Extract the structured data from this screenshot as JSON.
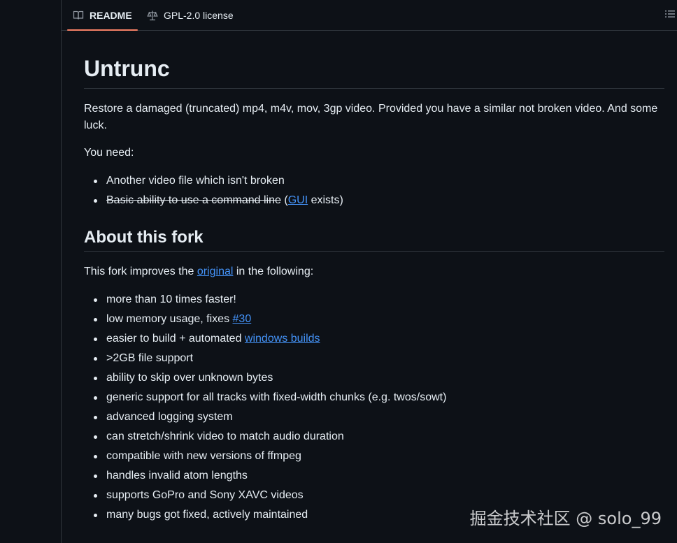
{
  "tabs": {
    "readme": "README",
    "license": "GPL-2.0 license"
  },
  "article": {
    "title": "Untrunc",
    "intro": "Restore a damaged (truncated) mp4, m4v, mov, 3gp video. Provided you have a similar not broken video. And some luck.",
    "you_need": "You need:",
    "need_items": {
      "item1": "Another video file which isn't broken",
      "item2_struck": "Basic ability to use a command line",
      "item2_open": " (",
      "item2_link": "GUI",
      "item2_close": " exists)"
    },
    "about_heading": "About this fork",
    "fork_intro_before": "This fork improves the ",
    "fork_intro_link": "original",
    "fork_intro_after": " in the following:",
    "fork_items": [
      {
        "text": "more than 10 times faster!"
      },
      {
        "text": "low memory usage, fixes ",
        "link": "#30"
      },
      {
        "text": "easier to build + automated ",
        "link": "windows builds"
      },
      {
        "text": ">2GB file support"
      },
      {
        "text": "ability to skip over unknown bytes"
      },
      {
        "text": "generic support for all tracks with fixed-width chunks (e.g. twos/sowt)"
      },
      {
        "text": "advanced logging system"
      },
      {
        "text": "can stretch/shrink video to match audio duration"
      },
      {
        "text": "compatible with new versions of ffmpeg"
      },
      {
        "text": "handles invalid atom lengths"
      },
      {
        "text": "supports GoPro and Sony XAVC videos"
      },
      {
        "text": "many bugs got fixed, actively maintained"
      }
    ]
  },
  "watermark": "掘金技术社区 @ solo_99",
  "colors": {
    "background": "#0d1117",
    "text": "#e6edf3",
    "link": "#4493f8",
    "tab_underline": "#f78166",
    "border": "#30363d"
  },
  "icons": {
    "readme": "book-icon",
    "license": "scale-icon",
    "toc": "list-icon"
  }
}
